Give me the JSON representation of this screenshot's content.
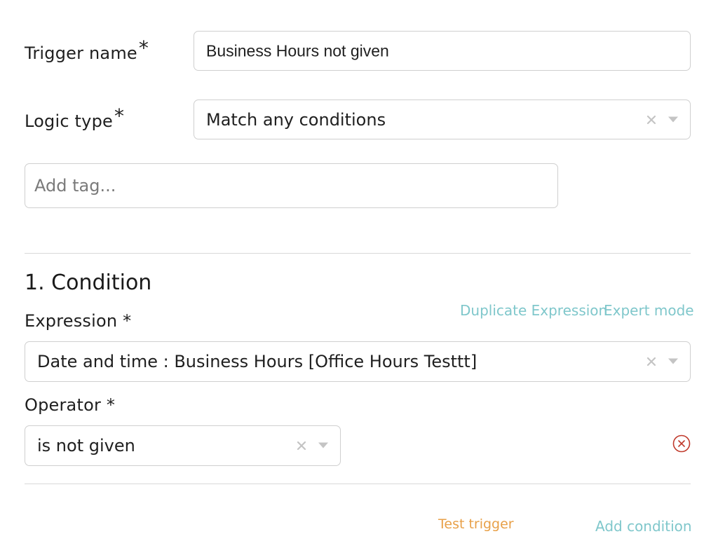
{
  "trigger": {
    "name_label": "Trigger name",
    "required_mark": "*",
    "name_value": "Business Hours not given",
    "logic_label": "Logic type",
    "logic_value": "Match any conditions",
    "tag_placeholder": "Add tag..."
  },
  "condition": {
    "heading": "1. Condition",
    "duplicate_link": "Duplicate Expression",
    "expert_link": "Expert mode",
    "expression_label": "Expression *",
    "expression_value": "Date and time : Business Hours [Office Hours Testtt]",
    "operator_label": "Operator *",
    "operator_value": "is not given"
  },
  "footer": {
    "test_trigger": "Test trigger",
    "add_condition": "Add condition"
  },
  "colors": {
    "teal_link": "#7fc7cb",
    "orange_link": "#e8a048",
    "delete_red": "#c0392b"
  },
  "icons": {
    "clear": "close-icon",
    "dropdown": "chevron-down-icon",
    "delete": "remove-circle-icon"
  }
}
